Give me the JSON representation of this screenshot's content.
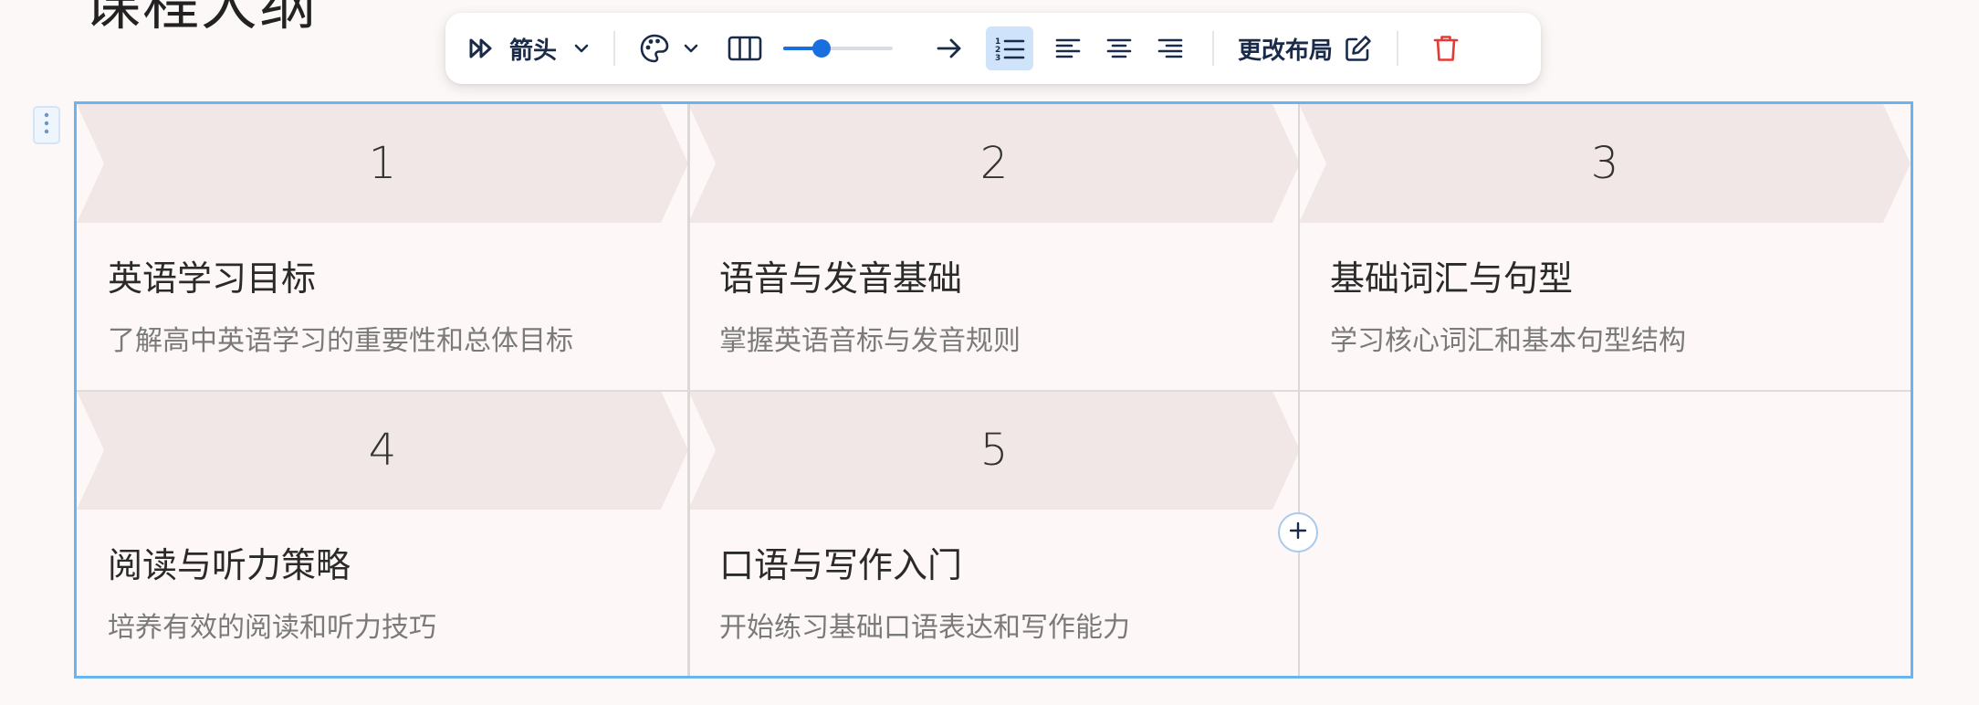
{
  "page": {
    "title": "课程大纲"
  },
  "toolbar": {
    "style_label": "箭头",
    "layout_label": "更改布局",
    "slider_level": 0.35,
    "accent_color": "#1a6fe0",
    "active_highlight": "#cfe3fa",
    "delete_color": "#e53935",
    "icons": [
      "fast-forward-icon",
      "chevron-down-icon",
      "palette-icon",
      "chevron-down-icon",
      "columns-icon",
      "arrow-right-icon",
      "numbered-list-icon",
      "align-left-icon",
      "align-center-icon",
      "align-right-icon",
      "edit-icon",
      "trash-icon"
    ]
  },
  "grid": {
    "selection_color": "#6bb4f2",
    "banner_color": "#f1e7e6",
    "items": [
      {
        "number": "1",
        "title": "英语学习目标",
        "desc": "了解高中英语学习的重要性和总体目标"
      },
      {
        "number": "2",
        "title": "语音与发音基础",
        "desc": "掌握英语音标与发音规则"
      },
      {
        "number": "3",
        "title": "基础词汇与句型",
        "desc": "学习核心词汇和基本句型结构"
      },
      {
        "number": "4",
        "title": "阅读与听力策略",
        "desc": "培养有效的阅读和听力技巧"
      },
      {
        "number": "5",
        "title": "口语与写作入门",
        "desc": "开始练习基础口语表达和写作能力"
      }
    ]
  }
}
